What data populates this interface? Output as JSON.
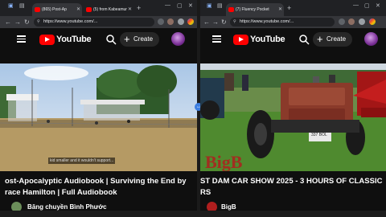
{
  "left": {
    "tabs": [
      {
        "label": "(865) Post-Ap",
        "active": true
      },
      {
        "label": "(5) from Kabeamur",
        "active": false
      }
    ],
    "url": "https://www.youtube.com/...",
    "logo_text": "YouTube",
    "create_label": "Create",
    "video_title_line1": "ost-Apocalyptic Audiobook | Surviving the End by",
    "video_title_line2": "race Hamilton | Full Audiobook",
    "channel_name": "Băng chuyền Bình Phước",
    "caption_text": "kid smaller and it wouldn't support..."
  },
  "right": {
    "tabs": [
      {
        "label": "(7) Fluency Pocket",
        "active": true
      }
    ],
    "url": "https://www.youtube.com/...",
    "logo_text": "YouTube",
    "create_label": "Create",
    "video_title_line1": "ST DAM CAR SHOW 2025 - 3 HOURS OF CLASSIC",
    "video_title_line2": "RS",
    "channel_name": "BigB",
    "watermark_text": "BigB",
    "plate_text": "337 BOL"
  },
  "icons": {
    "back": "back-arrow-icon",
    "forward": "forward-arrow-icon",
    "reload": "reload-icon",
    "search": "search-icon",
    "menu": "hamburger-menu-icon",
    "create": "plus-icon",
    "split": "split-view-icon"
  },
  "colors": {
    "yt_red": "#ff0000",
    "tab_active": "#35363a",
    "background": "#0f0f0f"
  }
}
